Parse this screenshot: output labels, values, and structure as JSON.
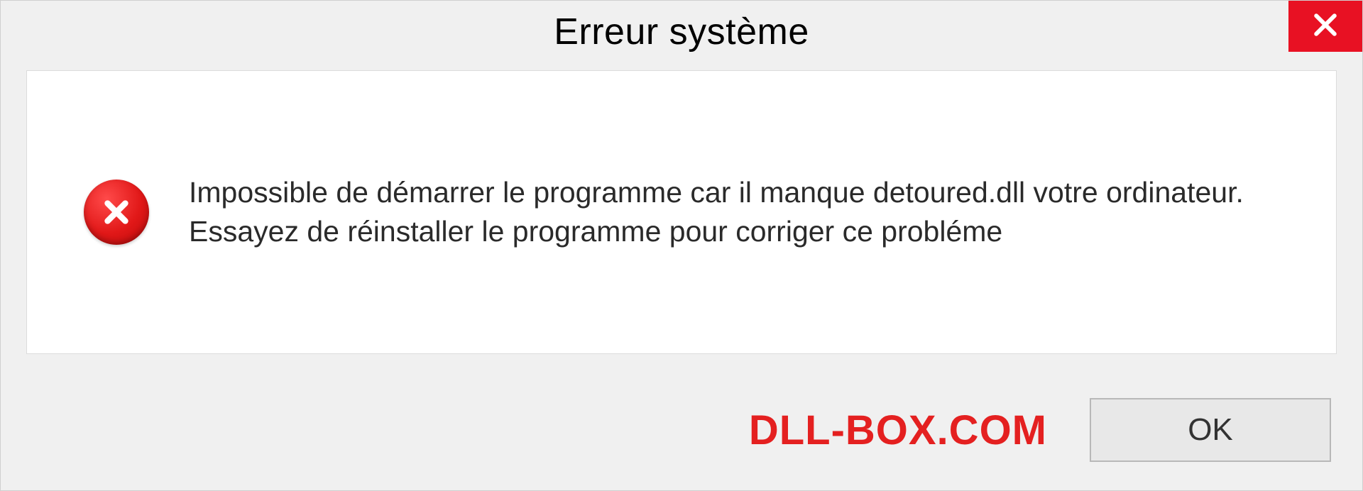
{
  "dialog": {
    "title": "Erreur système",
    "message": "Impossible de démarrer le programme car il manque detoured.dll votre ordinateur. Essayez de réinstaller le programme pour corriger ce probléme",
    "ok_label": "OK",
    "watermark": "DLL-BOX.COM",
    "icons": {
      "close": "close-icon",
      "error": "error-icon"
    },
    "colors": {
      "close_bg": "#e81123",
      "error_circle": "#d41616",
      "watermark": "#e42020",
      "panel_bg": "#ffffff",
      "dialog_bg": "#f0f0f0"
    }
  }
}
